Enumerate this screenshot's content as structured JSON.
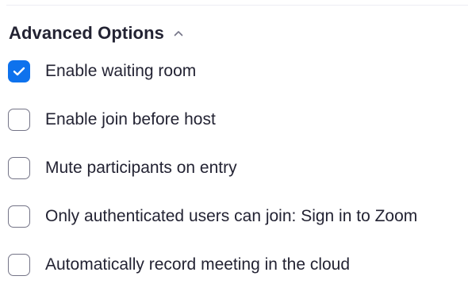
{
  "section": {
    "title": "Advanced Options",
    "expanded": true,
    "toggle_icon": "chevron-up-icon"
  },
  "options": [
    {
      "label": "Enable waiting room",
      "checked": true
    },
    {
      "label": "Enable join before host",
      "checked": false
    },
    {
      "label": "Mute participants on entry",
      "checked": false
    },
    {
      "label": "Only authenticated users can join: Sign in to Zoom",
      "checked": false
    },
    {
      "label": "Automatically record meeting in the cloud",
      "checked": false
    }
  ],
  "colors": {
    "accent": "#0e72ed",
    "text": "#232333",
    "checkbox_border": "#747487",
    "chevron": "#747487"
  }
}
